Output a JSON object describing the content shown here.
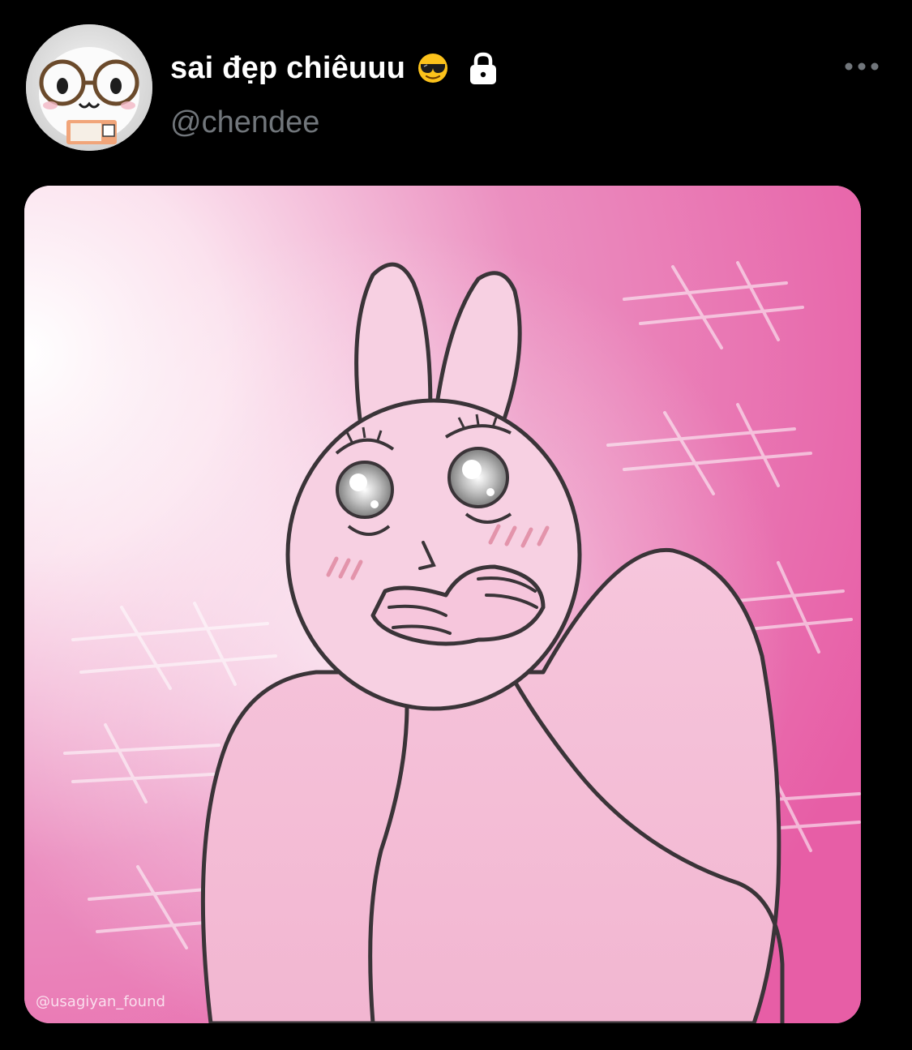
{
  "post": {
    "author": {
      "display_name": "sai đẹp chiêuuu",
      "handle": "@chendee",
      "emoji_icon": "smiling-face-with-sunglasses-icon",
      "protected_icon": "lock-icon"
    },
    "more_icon": "more-options-icon",
    "media": {
      "description_icon": "pink-bunny-illustration",
      "watermark": "@usagiyan_found"
    }
  },
  "colors": {
    "background": "#000000",
    "name_text": "#ffffff",
    "handle_text": "#71767b",
    "media_pink": "#e86aa9"
  }
}
